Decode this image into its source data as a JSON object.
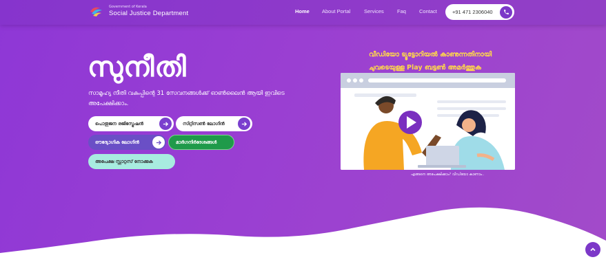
{
  "header": {
    "logo_small": "Government of Kerala",
    "logo_title": "Social Justice Department",
    "nav": [
      {
        "label": "Home",
        "active": true
      },
      {
        "label": "About Portal",
        "active": false
      },
      {
        "label": "Services",
        "active": false
      },
      {
        "label": "Faq",
        "active": false
      },
      {
        "label": "Contact",
        "active": false
      }
    ],
    "phone": "+91 471 2306040"
  },
  "hero": {
    "title": "സുനീതി",
    "description": "സാമൂഹ്യ നീതി വകുപ്പിന്റെ 31 സേവനങ്ങൾക്ക് ഓൺലൈൻ ആയി ഇവിടെ അപേക്ഷിക്കാം.",
    "buttons": [
      {
        "label": "പൊതുജന രജിസ്ട്രേഷൻ",
        "style": "white"
      },
      {
        "label": "സിറ്റിസൺ ലോഗിൻ",
        "style": "white"
      },
      {
        "label": "ഔദ്യോഗിക ലോഗിൻ",
        "style": "purple"
      },
      {
        "label": "മാർഗനിർദേശങ്ങൾ",
        "style": "green"
      },
      {
        "label": "അപേക്ഷ സ്റ്റാറ്റസ് നോക്കുക",
        "style": "mint"
      }
    ]
  },
  "tutorial": {
    "line1": "വീഡിയോ ട്യൂട്ടോറിയൽ കാണുന്നതിനായി",
    "line2": "ചുവടെയുള്ള Play ബട്ടൺ അമർത്തുക",
    "caption": "എങ്ങനെ അപേക്ഷിക്കാം? വീഡിയോ കാണാം.."
  },
  "colors": {
    "accent": "#7c38c8",
    "tutorial_text": "#ffd84a",
    "green_button": "#1f9a4a",
    "mint_button": "#a8ece0"
  },
  "icons": {
    "phone": "phone-icon",
    "arrow": "arrow-right-icon",
    "play": "play-icon",
    "scroll_top": "chevron-up-icon"
  }
}
